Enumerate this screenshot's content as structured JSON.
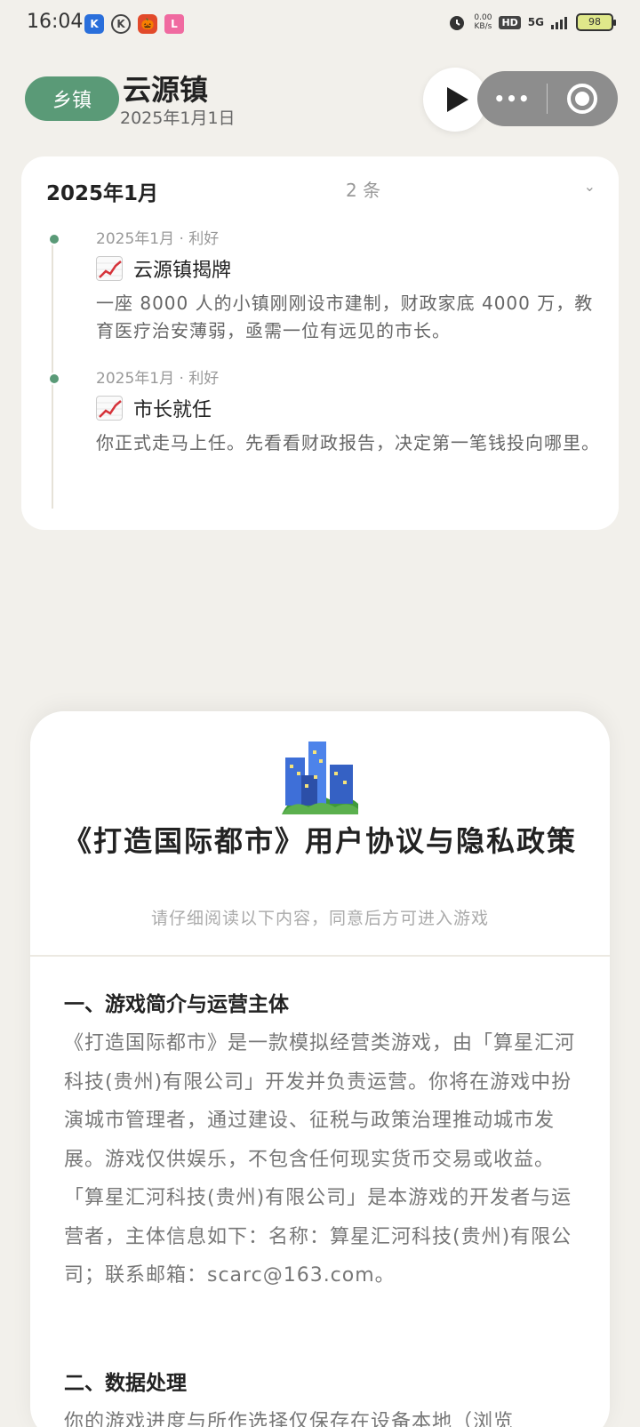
{
  "status_bar": {
    "time": "16:04",
    "app_icons": [
      "K",
      "K",
      "🎃",
      "L"
    ],
    "net_speed": "0.00",
    "net_unit": "KB/s",
    "hd": "HD",
    "network": "5G",
    "battery": "98"
  },
  "header": {
    "badge": "乡镇",
    "town": "云源镇",
    "date": "2025年1月1日",
    "capsule_more": "•••"
  },
  "timeline": {
    "month": "2025年1月",
    "count": "2 条",
    "items": [
      {
        "meta": "2025年1月 · 利好",
        "title": "云源镇揭牌",
        "body": "一座 8000 人的小镇刚刚设市建制，财政家底 4000 万，教育医疗治安薄弱，亟需一位有远见的市长。"
      },
      {
        "meta": "2025年1月 · 利好",
        "title": "市长就任",
        "body": "你正式走马上任。先看看财政报告，决定第一笔钱投向哪里。"
      }
    ]
  },
  "agreement": {
    "title": "《打造国际都市》用户协议与隐私政策",
    "subtitle": "请仔细阅读以下内容，同意后方可进入游戏",
    "sections": [
      {
        "heading": "一、游戏简介与运营主体",
        "body": "《打造国际都市》是一款模拟经营类游戏，由「算星汇河科技(贵州)有限公司」开发并负责运营。你将在游戏中扮演城市管理者，通过建设、征税与政策治理推动城市发展。游戏仅供娱乐，不包含任何现实货币交易或收益。「算星汇河科技(贵州)有限公司」是本游戏的开发者与运营者，主体信息如下：名称：算星汇河科技(贵州)有限公司；联系邮箱：scarc@163.com。"
      },
      {
        "heading": "二、数据处理",
        "body": "你的游戏进度与所作选择仅保存在设备本地（浏览"
      }
    ]
  },
  "colors": {
    "accent_green": "#5a9a77",
    "background": "#f2f0eb"
  }
}
